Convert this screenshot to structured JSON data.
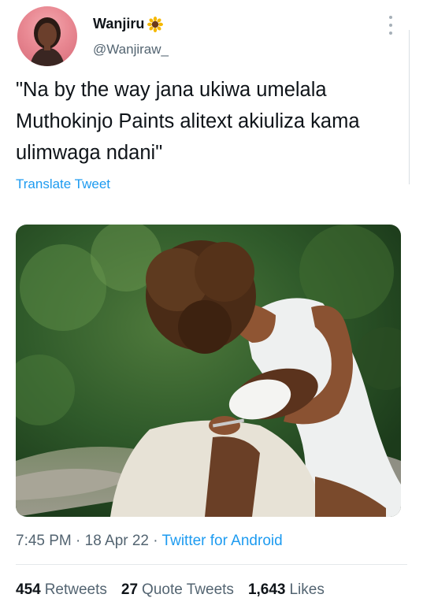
{
  "user": {
    "display_name": "Wanjiru",
    "display_emoji": "sunflower-icon",
    "handle": "@Wanjiraw_"
  },
  "tweet": {
    "text": "\"Na by the way jana ukiwa umelala Muthokinjo Paints alitext akiuliza kama ulimwaga ndani\"",
    "translate_label": "Translate Tweet"
  },
  "meta": {
    "time": "7:45 PM",
    "separator": "·",
    "date": "18 Apr 22",
    "source": "Twitter for Android"
  },
  "stats": {
    "retweets_count": "454",
    "retweets_label": "Retweets",
    "quotes_count": "27",
    "quotes_label": "Quote Tweets",
    "likes_count": "1,643",
    "likes_label": "Likes"
  },
  "colors": {
    "link": "#1d9bf0",
    "secondary_text": "#536471",
    "primary_text": "#0f1419"
  }
}
